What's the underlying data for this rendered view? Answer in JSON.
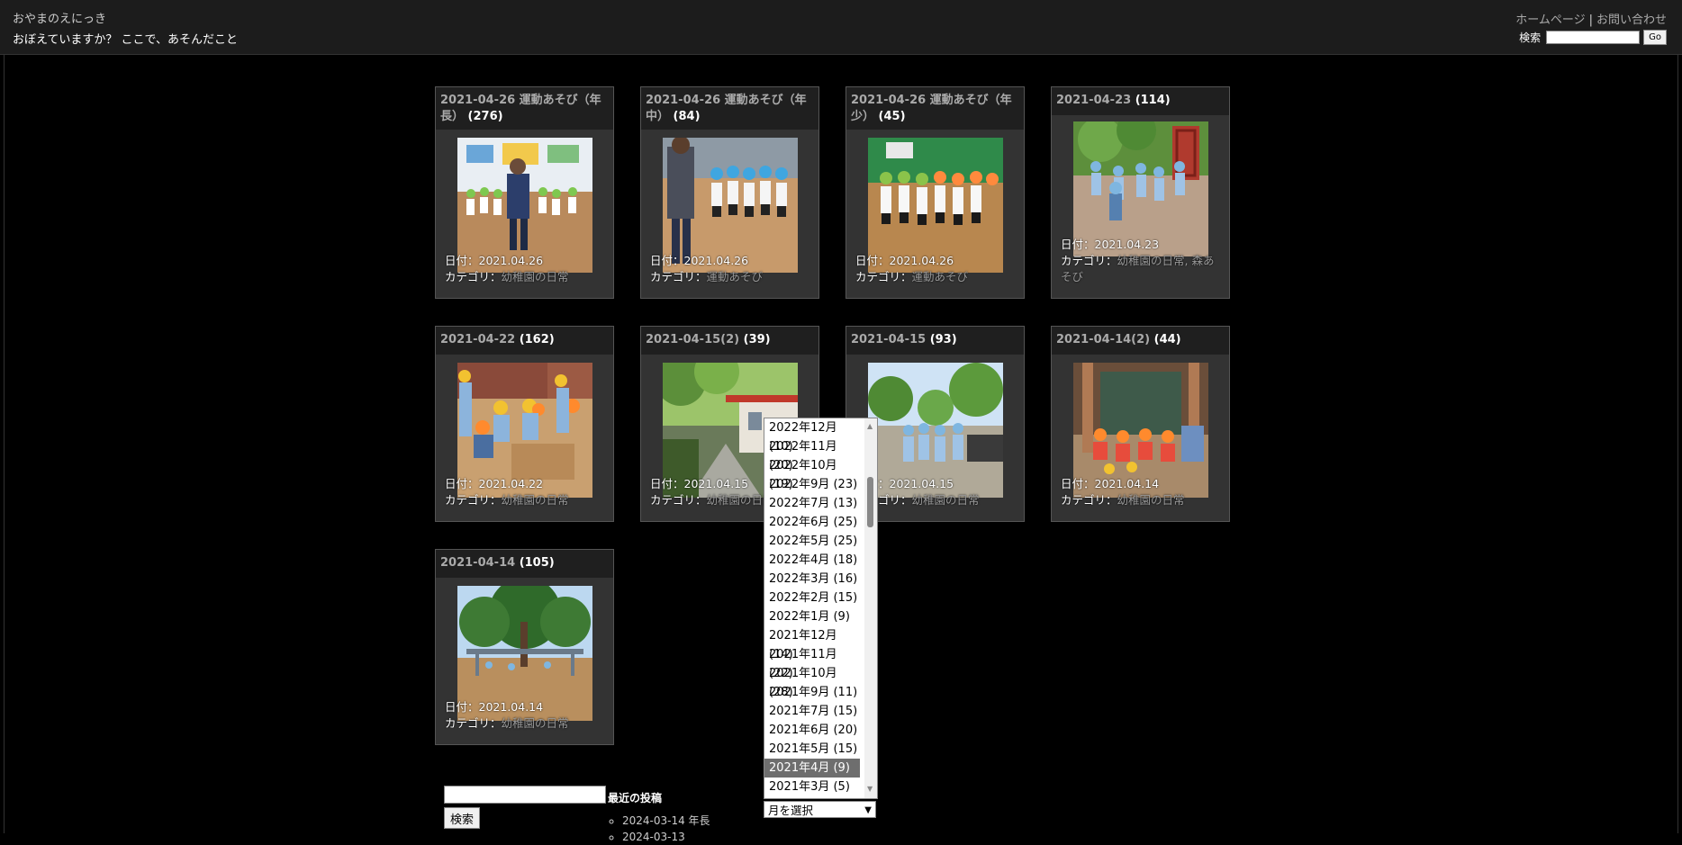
{
  "header": {
    "site_title": "おやまのえにっき",
    "tagline": "おぼえていますか？ ここで、あそんだこと",
    "links": [
      "ホームページ",
      "お問い合わせ"
    ],
    "search_label": "検索",
    "search_value": "",
    "go_label": "Go"
  },
  "albums": [
    {
      "title": "2021-04-26 運動あそび（年長）",
      "count": "(276)",
      "date_label": "日付：",
      "date": "2021.04.26",
      "cat_label": "カテゴリ：",
      "category": "幼稚園の日常"
    },
    {
      "title": "2021-04-26 運動あそび（年中）",
      "count": "(84)",
      "date_label": "日付：",
      "date": "2021.04.26",
      "cat_label": "カテゴリ：",
      "category": "運動あそび"
    },
    {
      "title": "2021-04-26 運動あそび（年少）",
      "count": "(45)",
      "date_label": "日付：",
      "date": "2021.04.26",
      "cat_label": "カテゴリ：",
      "category": "運動あそび"
    },
    {
      "title": "2021-04-23",
      "count": "(114)",
      "date_label": "日付：",
      "date": "2021.04.23",
      "cat_label": "カテゴリ：",
      "category": "幼稚園の日常, 森あそび"
    },
    {
      "title": "2021-04-22",
      "count": "(162)",
      "date_label": "日付：",
      "date": "2021.04.22",
      "cat_label": "カテゴリ：",
      "category": "幼稚園の日常"
    },
    {
      "title": "2021-04-15(2)",
      "count": "(39)",
      "date_label": "日付：",
      "date": "2021.04.15",
      "cat_label": "カテゴリ：",
      "category": "幼稚園の日常"
    },
    {
      "title": "2021-04-15",
      "count": "(93)",
      "date_label": "日付：",
      "date": "2021.04.15",
      "cat_label": "カテゴリ：",
      "category": "幼稚園の日常"
    },
    {
      "title": "2021-04-14(2)",
      "count": "(44)",
      "date_label": "日付：",
      "date": "2021.04.14",
      "cat_label": "カテゴリ：",
      "category": "幼稚園の日常"
    },
    {
      "title": "2021-04-14",
      "count": "(105)",
      "date_label": "日付：",
      "date": "2021.04.14",
      "cat_label": "カテゴリ：",
      "category": "幼稚園の日常"
    }
  ],
  "sidebar": {
    "search_value": "",
    "search_button": "検索",
    "recent_heading": "最近の投稿",
    "recent_posts": [
      "2024-03-14 年長",
      "2024-03-13"
    ]
  },
  "archive": {
    "options": [
      "2022年12月 (10)",
      "2022年11月 (20)",
      "2022年10月 (19)",
      "2022年9月 (23)",
      "2022年7月 (13)",
      "2022年6月 (25)",
      "2022年5月 (25)",
      "2022年4月 (18)",
      "2022年3月 (16)",
      "2022年2月 (15)",
      "2022年1月 (9)",
      "2021年12月 (14)",
      "2021年11月 (22)",
      "2021年10月 (28)",
      "2021年9月 (11)",
      "2021年7月 (15)",
      "2021年6月 (20)",
      "2021年5月 (15)",
      "2021年4月 (9)",
      "2021年3月 (5)"
    ],
    "selected_index": 18,
    "select_label": "月を選択"
  },
  "colors": {
    "background": "#000000",
    "card": "#333333",
    "link": "#aaaaaa"
  }
}
